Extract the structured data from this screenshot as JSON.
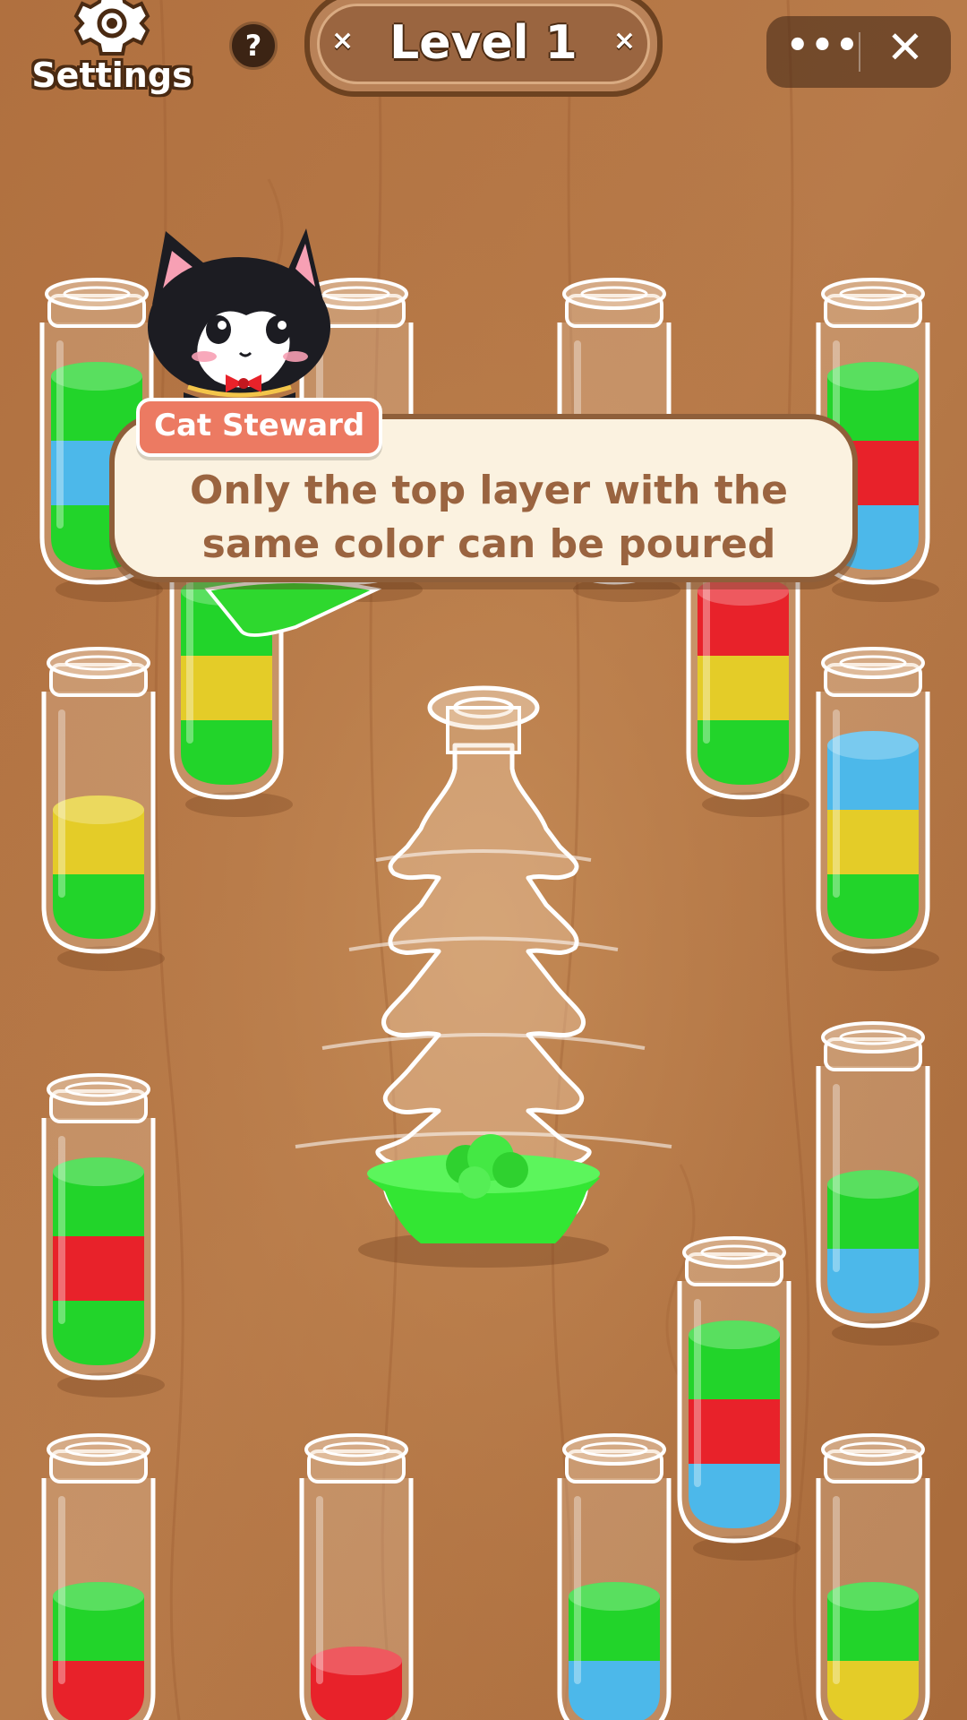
{
  "hud": {
    "settings_label": "Settings",
    "help_icon": "?",
    "level_title": "Level 1",
    "level_left_mark": "×",
    "level_right_mark": "×",
    "menu_more": "•••",
    "menu_close": "✕"
  },
  "dialog": {
    "speaker": "Cat Steward",
    "message_line1": "Only the top layer with the",
    "message_line2": "same color can be poured"
  },
  "colors": {
    "green": "#22d42a",
    "blue": "#4cb8ea",
    "red": "#e8222a",
    "yellow": "#e4cc28",
    "pink": "#ee6672",
    "lime": "#33e633"
  },
  "tubes_layers_bottom_to_top": [
    [
      "green",
      "blue",
      "green"
    ],
    [
      "green",
      "yellow",
      "green"
    ],
    [
      "pink"
    ],
    [
      "blue",
      "red",
      "green"
    ],
    [
      "green",
      "yellow",
      "red"
    ],
    [
      "green",
      "yellow"
    ],
    [
      "green",
      "yellow",
      "blue"
    ],
    [
      "green",
      "red",
      "green"
    ],
    [
      "blue",
      "green"
    ],
    [
      "blue",
      "red",
      "green"
    ],
    [
      "red",
      "green"
    ],
    [
      "red"
    ],
    [
      "blue",
      "green"
    ],
    [
      "yellow",
      "green"
    ]
  ],
  "tree_flask": {
    "fill_color": "lime"
  },
  "character": {
    "name_icon": "tuxedo-cat-icon"
  }
}
